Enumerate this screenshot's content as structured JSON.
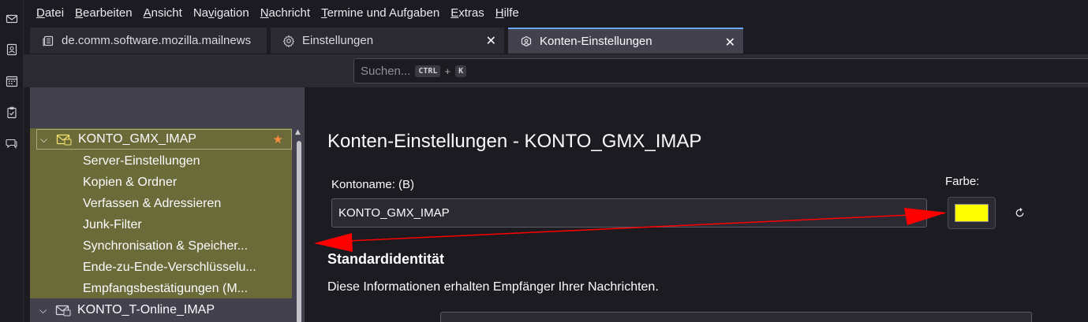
{
  "colors": {
    "accent": "#6aa8ff",
    "selection": "#6b6b3a",
    "account_color": "#ffff00",
    "star": "#ff8a3c",
    "annotation_arrow": "#ff0000"
  },
  "spaces": [
    {
      "icon": "mail-icon"
    },
    {
      "icon": "address-book-icon"
    },
    {
      "icon": "calendar-icon"
    },
    {
      "icon": "tasks-icon"
    },
    {
      "icon": "chat-icon"
    }
  ],
  "menubar": {
    "items": [
      {
        "underline": "D",
        "rest": "atei"
      },
      {
        "underline": "B",
        "rest": "earbeiten"
      },
      {
        "underline": "A",
        "rest": "nsicht"
      },
      {
        "underline": "",
        "pre": "Na",
        "u2": "v",
        "rest": "igation"
      },
      {
        "underline": "N",
        "rest": "achricht"
      },
      {
        "underline": "T",
        "rest": "ermine und Aufgaben"
      },
      {
        "underline": "E",
        "rest": "xtras"
      },
      {
        "underline": "H",
        "rest": "ilfe"
      }
    ]
  },
  "tabs": [
    {
      "label": "de.comm.software.mozilla.mailnews",
      "icon": "newsgroup-icon",
      "close": "✕"
    },
    {
      "label": "Einstellungen",
      "icon": "gear-icon",
      "close": "✕"
    },
    {
      "label": "Konten-Einstellungen",
      "icon": "account-settings-icon",
      "close": "✕"
    }
  ],
  "search": {
    "placeholder": "Suchen...",
    "key1": "CTRL",
    "plus": "+",
    "key2": "K"
  },
  "sidebar": {
    "accounts": [
      {
        "name": "KONTO_GMX_IMAP",
        "expanded": true,
        "selected": true,
        "default": true,
        "items": [
          "Server-Einstellungen",
          "Kopien & Ordner",
          "Verfassen & Adressieren",
          "Junk-Filter",
          "Synchronisation & Speicher...",
          "Ende-zu-Ende-Verschlüsselu...",
          "Empfangsbestätigungen (M..."
        ]
      },
      {
        "name": "KONTO_T-Online_IMAP",
        "expanded": true,
        "selected": false,
        "default": false,
        "items": []
      }
    ]
  },
  "main": {
    "title": "Konten-Einstellungen - KONTO_GMX_IMAP",
    "account_name_label": "Kontoname: (B)",
    "account_name_value": "KONTO_GMX_IMAP",
    "color_label": "Farbe:",
    "section_heading": "Standardidentität",
    "section_desc": "Diese Informationen erhalten Empfänger Ihrer Nachrichten."
  }
}
